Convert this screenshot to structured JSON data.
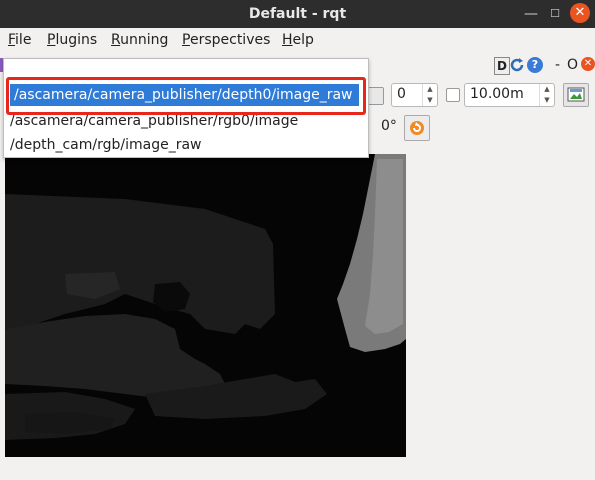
{
  "window": {
    "title": "Default - rqt"
  },
  "menubar": {
    "items": [
      {
        "label": "File",
        "u": "F",
        "rest": "ile"
      },
      {
        "label": "Plugins",
        "u": "P",
        "rest": "lugins"
      },
      {
        "label": "Running",
        "u": "R",
        "rest": "unning"
      },
      {
        "label": "Perspectives",
        "u": "P",
        "rest": "erspectives"
      },
      {
        "label": "Help",
        "u": "H",
        "rest": "elp"
      }
    ]
  },
  "panel_controls": {
    "d_label": "D",
    "dash": "-",
    "o_label": "O"
  },
  "topic_dropdown": {
    "options": [
      "/ascamera/camera_publisher/depth0/image_raw",
      "/ascamera/camera_publisher/rgb0/image",
      "/depth_cam/rgb/image_raw"
    ],
    "selected_index": 0
  },
  "toolbar": {
    "spin_value": "0",
    "distance_value": "10.00m",
    "rotation_label": "0°"
  },
  "colors": {
    "accent": "#2f7bd8",
    "highlight": "#e8261c",
    "close": "#e95420"
  }
}
